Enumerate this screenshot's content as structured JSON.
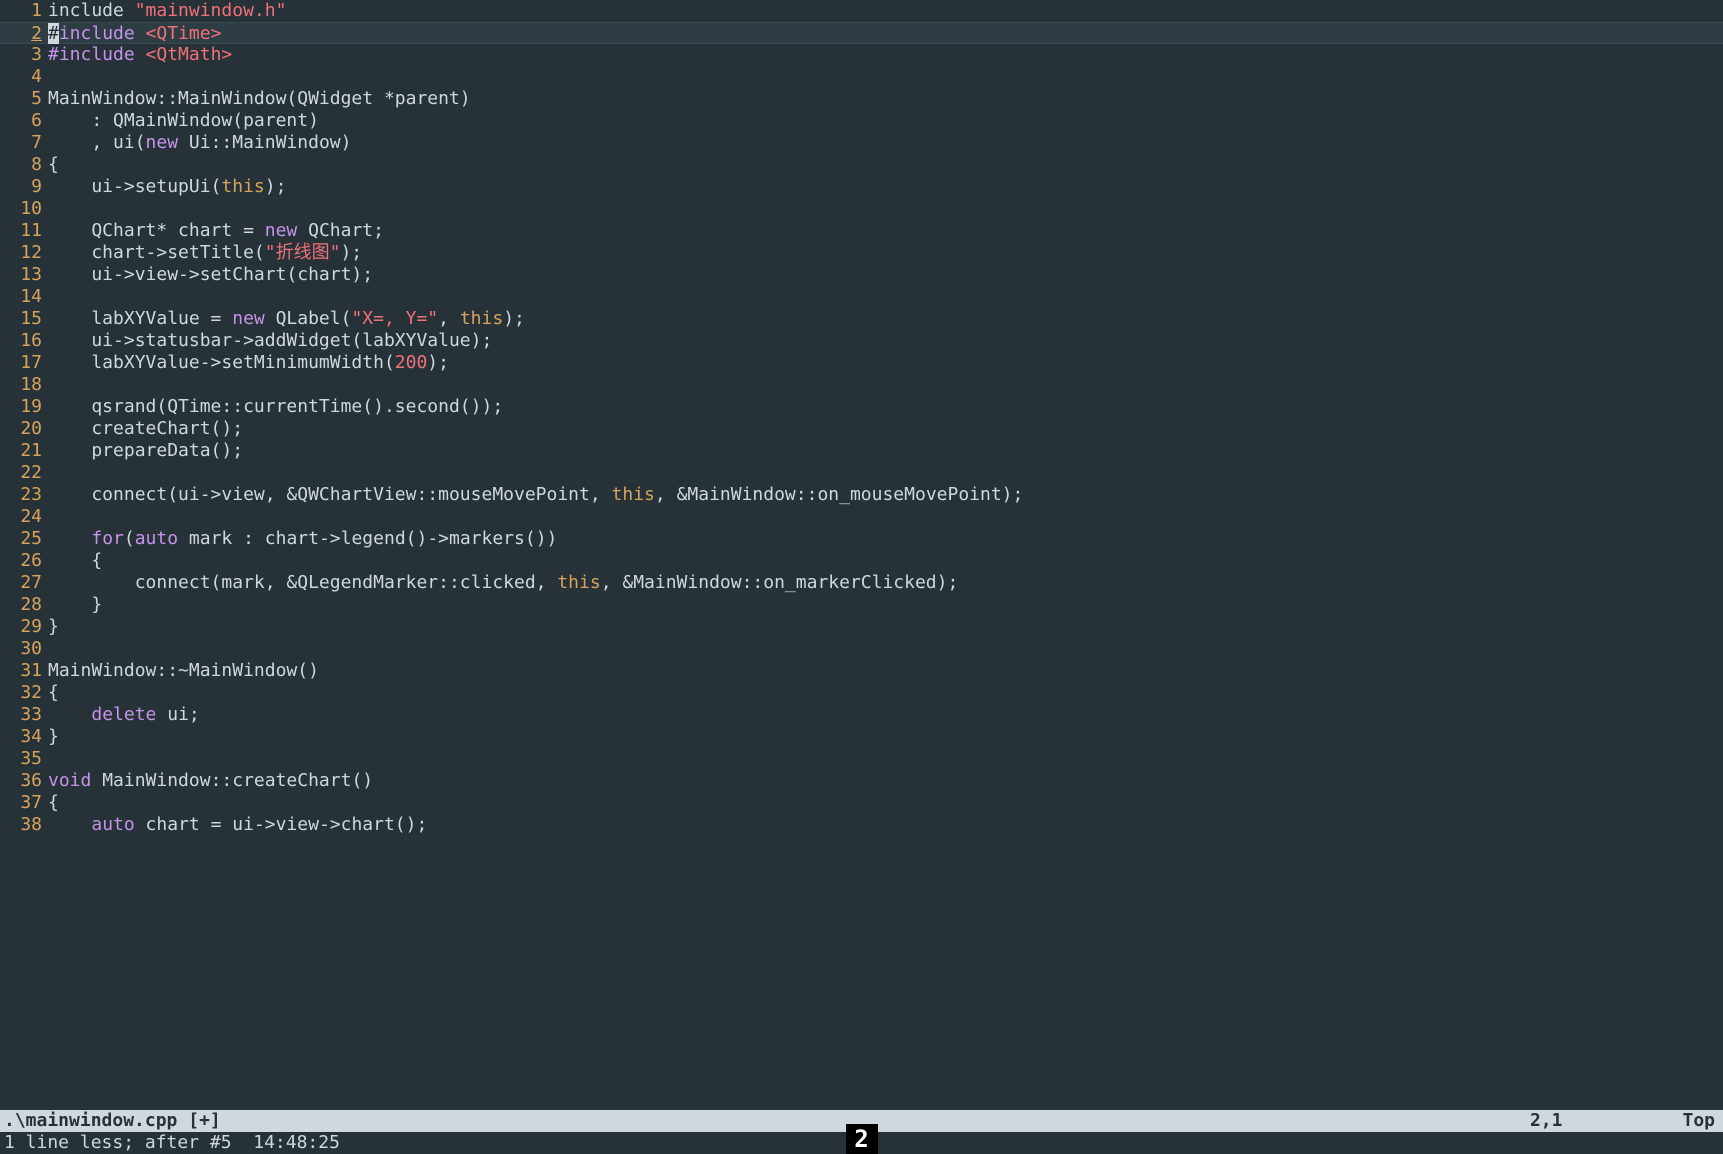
{
  "status": {
    "filename": ".\\mainwindow.cpp [+]",
    "position": "2,1",
    "scroll": "Top"
  },
  "cmdline": "1 line less; after #5  14:48:25",
  "badge": "2",
  "cursor_line": 2,
  "lines": [
    {
      "n": 1,
      "tokens": [
        [
          "plain",
          "include "
        ],
        [
          "str",
          "\"mainwindow.h\""
        ]
      ]
    },
    {
      "n": 2,
      "tokens": [
        [
          "cursor",
          "#"
        ],
        [
          "pre",
          "include "
        ],
        [
          "inc",
          "<QTime>"
        ]
      ]
    },
    {
      "n": 3,
      "tokens": [
        [
          "pre",
          "#include "
        ],
        [
          "inc",
          "<QtMath>"
        ]
      ]
    },
    {
      "n": 4,
      "tokens": []
    },
    {
      "n": 5,
      "tokens": [
        [
          "plain",
          "MainWindow::MainWindow(QWidget *parent)"
        ]
      ]
    },
    {
      "n": 6,
      "tokens": [
        [
          "plain",
          "    : QMainWindow(parent)"
        ]
      ]
    },
    {
      "n": 7,
      "tokens": [
        [
          "plain",
          "    , ui("
        ],
        [
          "kw",
          "new"
        ],
        [
          "plain",
          " Ui::MainWindow)"
        ]
      ]
    },
    {
      "n": 8,
      "tokens": [
        [
          "plain",
          "{"
        ]
      ]
    },
    {
      "n": 9,
      "tokens": [
        [
          "plain",
          "    ui->setupUi("
        ],
        [
          "thiskw",
          "this"
        ],
        [
          "plain",
          ");"
        ]
      ]
    },
    {
      "n": 10,
      "tokens": []
    },
    {
      "n": 11,
      "tokens": [
        [
          "plain",
          "    QChart* chart = "
        ],
        [
          "kw",
          "new"
        ],
        [
          "plain",
          " QChart;"
        ]
      ]
    },
    {
      "n": 12,
      "tokens": [
        [
          "plain",
          "    chart->setTitle("
        ],
        [
          "str",
          "\"折线图\""
        ],
        [
          "plain",
          ");"
        ]
      ]
    },
    {
      "n": 13,
      "tokens": [
        [
          "plain",
          "    ui->view->setChart(chart);"
        ]
      ]
    },
    {
      "n": 14,
      "tokens": []
    },
    {
      "n": 15,
      "tokens": [
        [
          "plain",
          "    labXYValue = "
        ],
        [
          "kw",
          "new"
        ],
        [
          "plain",
          " QLabel("
        ],
        [
          "str",
          "\"X=, Y=\""
        ],
        [
          "plain",
          ", "
        ],
        [
          "thiskw",
          "this"
        ],
        [
          "plain",
          ");"
        ]
      ]
    },
    {
      "n": 16,
      "tokens": [
        [
          "plain",
          "    ui->statusbar->addWidget(labXYValue);"
        ]
      ]
    },
    {
      "n": 17,
      "tokens": [
        [
          "plain",
          "    labXYValue->setMinimumWidth("
        ],
        [
          "num",
          "200"
        ],
        [
          "plain",
          ");"
        ]
      ]
    },
    {
      "n": 18,
      "tokens": []
    },
    {
      "n": 19,
      "tokens": [
        [
          "plain",
          "    qsrand(QTime::currentTime().second());"
        ]
      ]
    },
    {
      "n": 20,
      "tokens": [
        [
          "plain",
          "    createChart();"
        ]
      ]
    },
    {
      "n": 21,
      "tokens": [
        [
          "plain",
          "    prepareData();"
        ]
      ]
    },
    {
      "n": 22,
      "tokens": []
    },
    {
      "n": 23,
      "tokens": [
        [
          "plain",
          "    connect(ui->view, &QWChartView::mouseMovePoint, "
        ],
        [
          "thiskw",
          "this"
        ],
        [
          "plain",
          ", &MainWindow::on_mouseMovePoint);"
        ]
      ]
    },
    {
      "n": 24,
      "tokens": []
    },
    {
      "n": 25,
      "tokens": [
        [
          "plain",
          "    "
        ],
        [
          "kw",
          "for"
        ],
        [
          "plain",
          "("
        ],
        [
          "kw",
          "auto"
        ],
        [
          "plain",
          " mark : chart->legend()->markers())"
        ]
      ]
    },
    {
      "n": 26,
      "tokens": [
        [
          "plain",
          "    {"
        ]
      ]
    },
    {
      "n": 27,
      "tokens": [
        [
          "plain",
          "        connect(mark, &QLegendMarker::clicked, "
        ],
        [
          "thiskw",
          "this"
        ],
        [
          "plain",
          ", &MainWindow::on_markerClicked);"
        ]
      ]
    },
    {
      "n": 28,
      "tokens": [
        [
          "plain",
          "    }"
        ]
      ]
    },
    {
      "n": 29,
      "tokens": [
        [
          "plain",
          "}"
        ]
      ]
    },
    {
      "n": 30,
      "tokens": []
    },
    {
      "n": 31,
      "tokens": [
        [
          "plain",
          "MainWindow::~MainWindow()"
        ]
      ]
    },
    {
      "n": 32,
      "tokens": [
        [
          "plain",
          "{"
        ]
      ]
    },
    {
      "n": 33,
      "tokens": [
        [
          "plain",
          "    "
        ],
        [
          "kw",
          "delete"
        ],
        [
          "plain",
          " ui;"
        ]
      ]
    },
    {
      "n": 34,
      "tokens": [
        [
          "plain",
          "}"
        ]
      ]
    },
    {
      "n": 35,
      "tokens": []
    },
    {
      "n": 36,
      "tokens": [
        [
          "kw",
          "void"
        ],
        [
          "plain",
          " MainWindow::createChart()"
        ]
      ]
    },
    {
      "n": 37,
      "tokens": [
        [
          "plain",
          "{"
        ]
      ]
    },
    {
      "n": 38,
      "tokens": [
        [
          "plain",
          "    "
        ],
        [
          "kw",
          "auto"
        ],
        [
          "plain",
          " chart = ui->view->chart();"
        ]
      ]
    }
  ]
}
